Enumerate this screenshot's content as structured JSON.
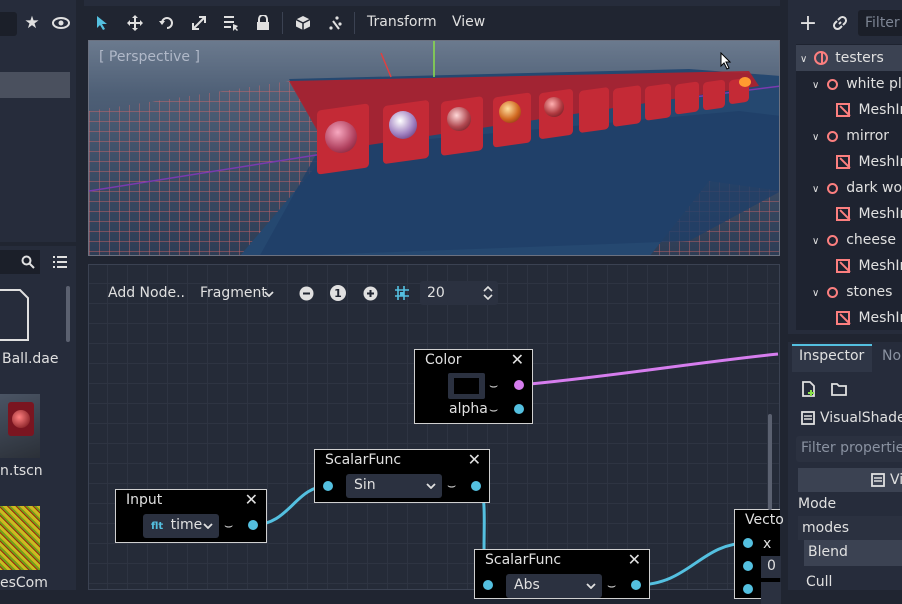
{
  "toolbar": {
    "menus": [
      "Transform",
      "View"
    ]
  },
  "viewport": {
    "label": "[ Perspective ]"
  },
  "shader_toolbar": {
    "add_node": "Add Node..",
    "mode": "Fragment",
    "zoom_reset": "1",
    "snap_value": "20"
  },
  "nodes": {
    "color": {
      "title": "Color",
      "port_alpha": "alpha"
    },
    "scalarfunc1": {
      "title": "ScalarFunc",
      "func": "Sin"
    },
    "input": {
      "title": "Input",
      "type": "flt",
      "value": "time"
    },
    "scalarfunc2": {
      "title": "ScalarFunc",
      "func": "Abs"
    },
    "vector": {
      "title": "Vecto",
      "port_x": "x",
      "port_0": "0"
    }
  },
  "filesystem": {
    "files": [
      "Ball.dae",
      "n.tscn",
      "esCom"
    ]
  },
  "scene_tree": {
    "filter_placeholder": "Filter n",
    "root": "testers",
    "items": [
      {
        "label": "white plas",
        "child": "MeshIn"
      },
      {
        "label": "mirror",
        "child": "MeshIn"
      },
      {
        "label": "dark woo",
        "child": "MeshIn"
      },
      {
        "label": "cheese",
        "child": "MeshIn"
      },
      {
        "label": "stones",
        "child": "MeshIn"
      }
    ]
  },
  "inspector": {
    "tabs": [
      "Inspector",
      "No"
    ],
    "resource": "VisualShader",
    "filter_placeholder": "Filter properties",
    "header": "Vi",
    "mode_label": "Mode",
    "modes_label": "modes",
    "blend": "Blend",
    "cull": "Cull"
  },
  "colors": {
    "accent": "#54c0e0",
    "vec_port": "#d67dee",
    "node_icon": "#fc7f7f"
  }
}
